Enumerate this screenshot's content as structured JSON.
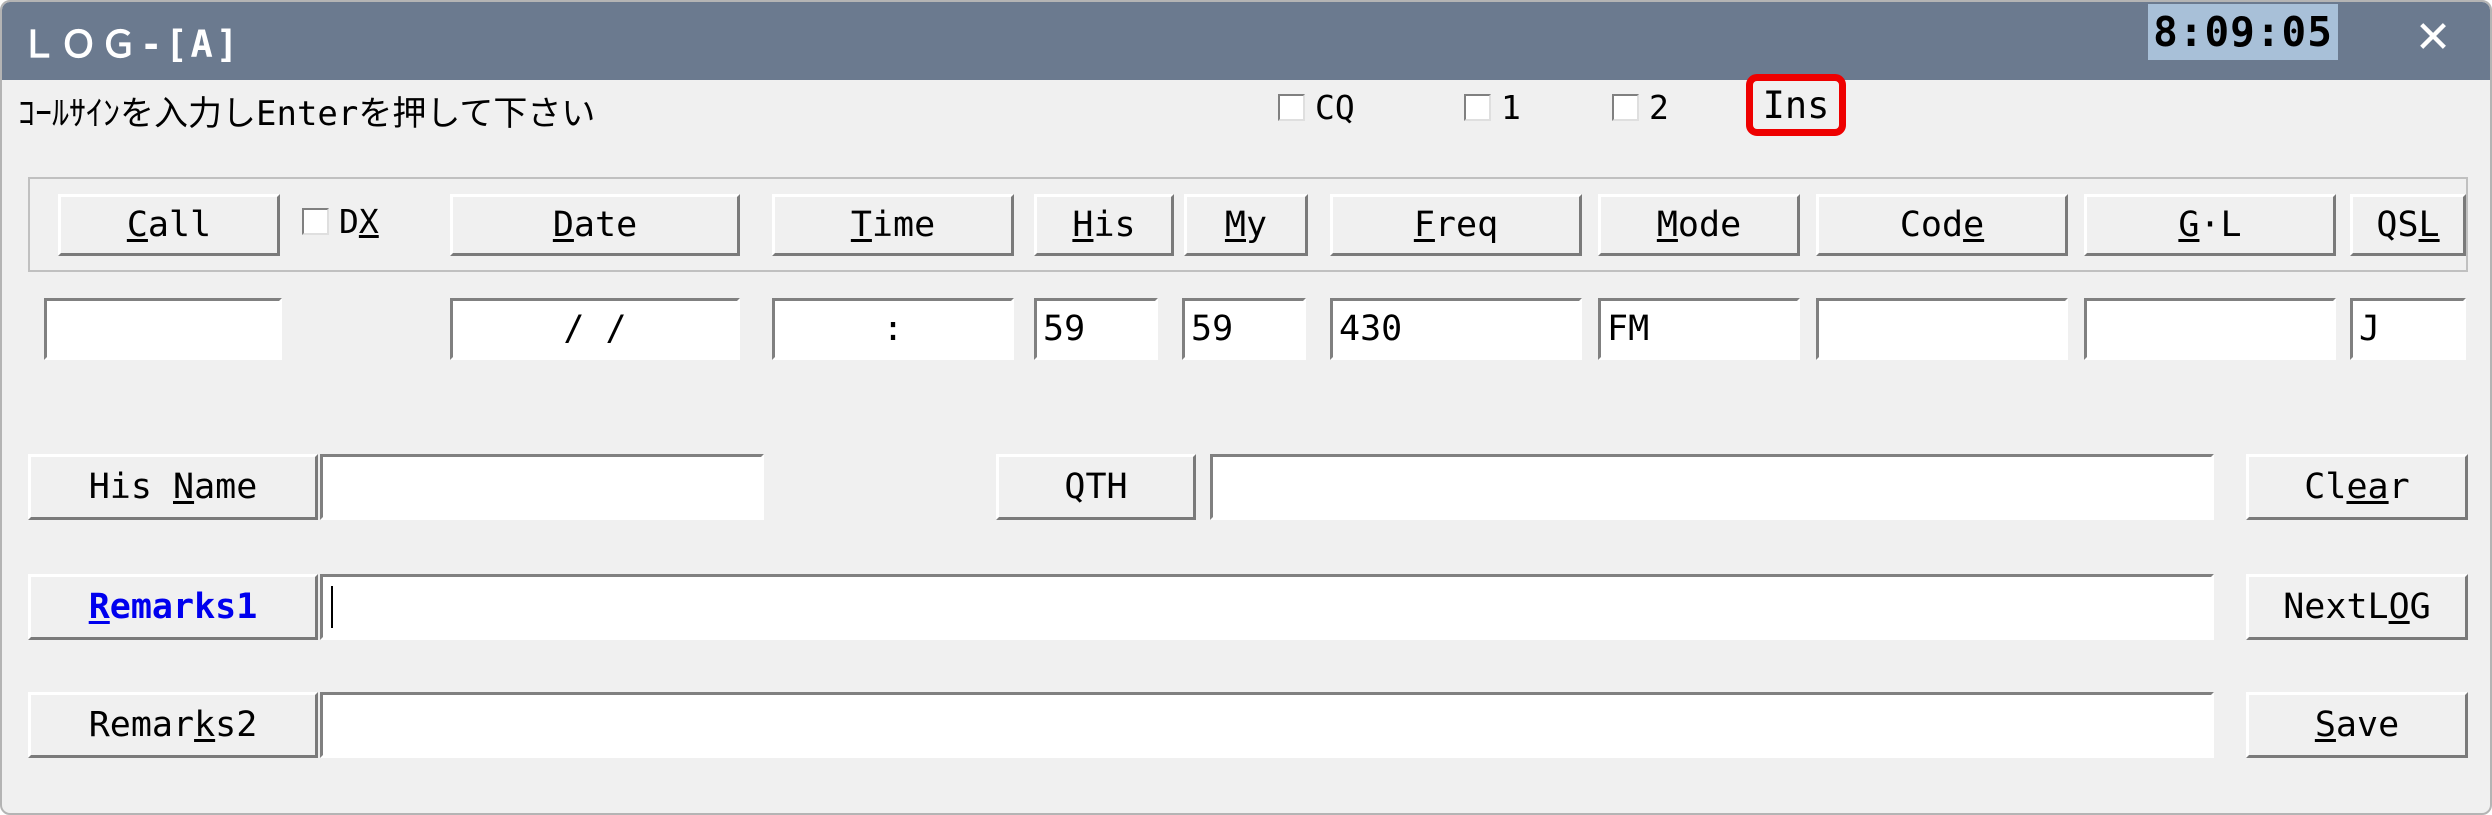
{
  "window": {
    "title": "ＬＯＧ-[A]",
    "clock": "8:09:05",
    "close_icon": "close-icon",
    "close_glyph": "✕",
    "accent_red": "#ee0000",
    "titlebar_color": "#6b7a8f",
    "clock_bg": "#a8c0d8",
    "face_color": "#f0f0f0",
    "link_blue": "#0000ee"
  },
  "instruction": {
    "text": "ｺｰﾙｻｲﾝを入力しEnterを押して下さい"
  },
  "toggles": [
    {
      "label": "CQ",
      "checked": false
    },
    {
      "label": "1",
      "checked": false
    },
    {
      "label": "2",
      "checked": false
    }
  ],
  "ins_indicator": {
    "label": "Ins",
    "highlighted": true,
    "highlight_color": "#ee0000"
  },
  "fields": {
    "call": {
      "label": "Call",
      "accel": "C",
      "value": ""
    },
    "dx": {
      "label": "DX",
      "accel": "X",
      "checked": false
    },
    "date": {
      "label": "Date",
      "accel": "D",
      "value": "  /  /  "
    },
    "time": {
      "label": "Time",
      "accel": "T",
      "value": ":"
    },
    "his": {
      "label": "His",
      "accel": "H",
      "value": "59"
    },
    "my": {
      "label": "My",
      "accel": "M",
      "value": "59"
    },
    "freq": {
      "label": "Freq",
      "accel": "F",
      "value": "430"
    },
    "mode": {
      "label": "Mode",
      "accel": "M",
      "value": "FM"
    },
    "code": {
      "label": "Code",
      "accel": "e",
      "value": ""
    },
    "gl": {
      "label": "G·L",
      "accel": "G",
      "value": ""
    },
    "qsl": {
      "label": "QSL",
      "accel": "L",
      "value": "J"
    },
    "his_name": {
      "label": "His Name",
      "accel": "N",
      "value": ""
    },
    "qth": {
      "label": "QTH",
      "accel": "",
      "value": ""
    },
    "remarks1": {
      "label": "Remarks1",
      "accel": "R",
      "value": "",
      "has_caret": true
    },
    "remarks2": {
      "label": "Remarks2",
      "accel": "k",
      "value": ""
    }
  },
  "actions": {
    "clear": {
      "label": "Clear",
      "accel": "ea"
    },
    "nextlog": {
      "label": "NextLOG",
      "accel": "O"
    },
    "save": {
      "label": "Save",
      "accel": "S"
    }
  }
}
